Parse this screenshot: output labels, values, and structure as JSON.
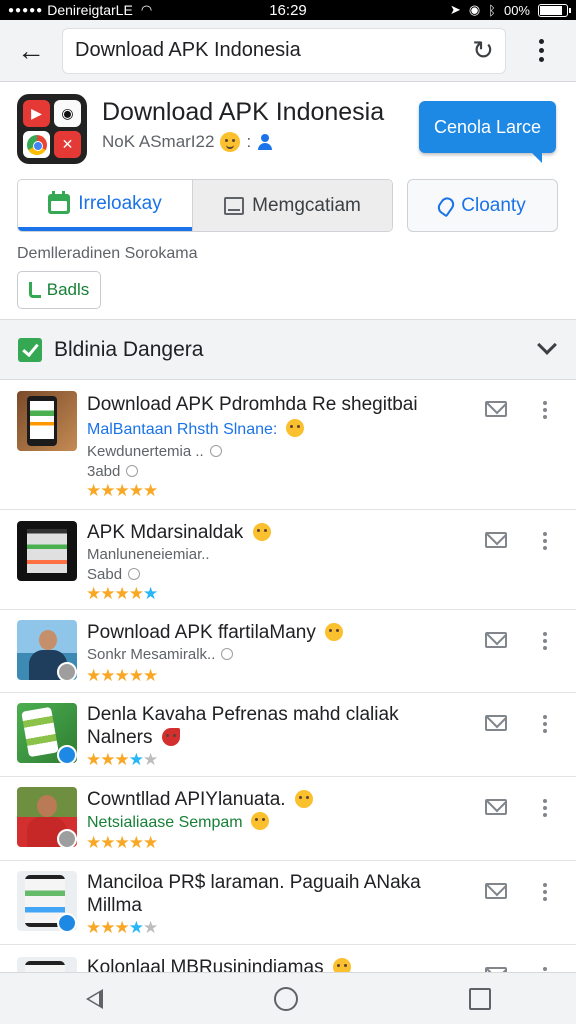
{
  "status_bar": {
    "carrier": "DenireigtarLE",
    "time": "16:29",
    "battery": "00%",
    "battery_level": 0.92
  },
  "address_bar": {
    "url_text": "Download APK Indonesia"
  },
  "app_header": {
    "title": "Download APK Indonesia",
    "subtitle": "NoK ASmarI22",
    "subtitle_suffix": ":",
    "cta_label": "Cenola Larce",
    "tabs": [
      {
        "label": "Irreloakay",
        "icon": "calendar-icon",
        "active": true
      },
      {
        "label": "Memgcatiam",
        "icon": "note-icon",
        "active": false
      }
    ],
    "secondary_button_label": "Cloanty",
    "description": "Demlleradinen  Sorokama",
    "chip_label": "Badls"
  },
  "section": {
    "title": "Bldinia Dangera",
    "collapsed": false
  },
  "items": [
    {
      "title": "Download APK Pdromhda Re shegitbai",
      "subtitle": "MalBantaan Rhsth Slnane:",
      "meta": "Kewdunertemia ..",
      "meta2": "3abd",
      "rating": 5
    },
    {
      "title": "APK Mdarsinaldak",
      "meta": "Manluneneiemiar..",
      "meta2": "Sabd",
      "rating": 4.5
    },
    {
      "title": "Pownload APK ffartilaMany",
      "meta": "Sonkr Mesamiralk..",
      "rating": 5
    },
    {
      "title": "Denla Kavaha Pefrenas mahd claliak Nalners",
      "rating": 3.5
    },
    {
      "title": "Cowntllad APIYlanuata.",
      "subtitle": "Netsialiaase Sempam",
      "rating": 5
    },
    {
      "title": "Manciloa PR$ laraman. Paguaih ANaka Millma",
      "rating": 3.5
    },
    {
      "title": "Kolonlaal MBRusinindiamas"
    }
  ]
}
